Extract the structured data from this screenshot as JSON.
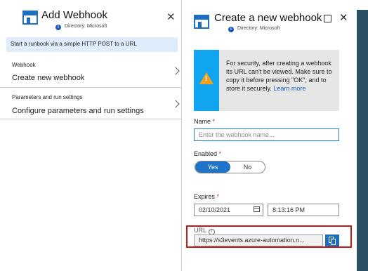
{
  "left_blade": {
    "title": "Add Webhook",
    "directory": "Directory: Microsoft",
    "close_glyph": "✕",
    "banner": "Start a runbook via a simple HTTP POST to a URL",
    "rows": [
      {
        "label": "Webhook",
        "value": "Create new webhook"
      },
      {
        "label": "Parameters and run settings",
        "value": "Configure parameters and run settings"
      }
    ]
  },
  "right_blade": {
    "title": "Create a new webhook",
    "directory": "Directory: Microsoft",
    "close_glyph": "✕",
    "warning": {
      "text": "For security, after creating a webhook its URL can't be viewed. Make sure to copy it before pressing \"OK\", and to store it securely.",
      "link": "Learn more"
    },
    "name": {
      "label": "Name",
      "required": "*",
      "placeholder": "Enter the webhook name...",
      "value": ""
    },
    "enabled": {
      "label": "Enabled",
      "required": "*",
      "yes": "Yes",
      "no": "No",
      "selected": "Yes"
    },
    "expires": {
      "label": "Expires",
      "required": "*",
      "date": "02/10/2021",
      "time": "8:13:16 PM"
    },
    "url": {
      "label": "URL",
      "value": "https://s3events.azure-automation.n..."
    }
  },
  "colors": {
    "accent": "#1e74c8",
    "banner": "#deecfb",
    "warning_strip": "#12a5ef",
    "warning_icon": "#f5a01d",
    "highlight_border": "#c41a1a",
    "scrollbar": "#2b4f64"
  },
  "icons": {
    "blade": "automation-blade-icon",
    "info": "info-icon",
    "warning": "warning-icon",
    "calendar": "calendar-icon",
    "copy": "copy-icon",
    "chevron": "chevron-right-icon"
  }
}
